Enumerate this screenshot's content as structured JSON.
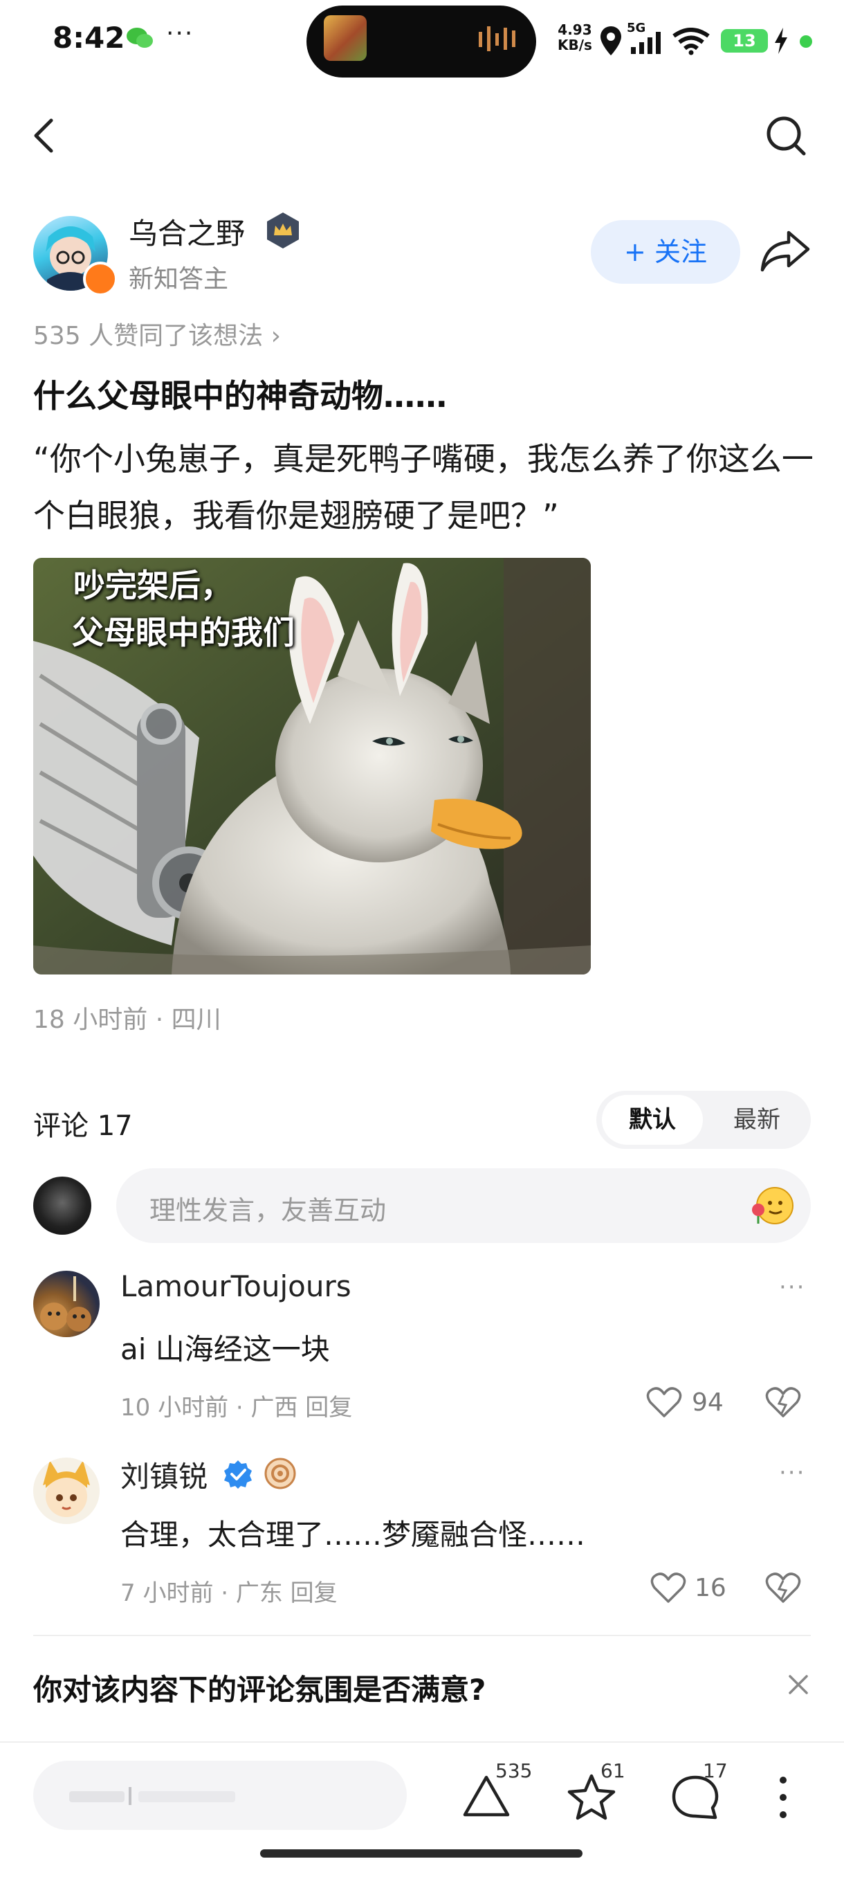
{
  "status_bar": {
    "time": "8:42",
    "dots": "···",
    "speed_value": "4.93",
    "speed_unit": "KB/s",
    "network": "5G",
    "battery": "13"
  },
  "post": {
    "author_name": "乌合之野",
    "author_subtitle": "新知答主",
    "follow_label": "+ 关注",
    "likes_line": "535 人赞同了该想法 ›",
    "title": "什么父母眼中的神奇动物……",
    "body": "“你个小兔崽子，真是死鸭子嘴硬，我怎么养了你这么一个白眼狼，我看你是翅膀硬了是吧？”",
    "image_caption_line1": "吵完架后，",
    "image_caption_line2": "父母眼中的我们",
    "meta": "18 小时前 · 四川"
  },
  "comments": {
    "header": "评论 17",
    "sort_default": "默认",
    "sort_latest": "最新",
    "input_placeholder": "理性发言，友善互动",
    "items": [
      {
        "name": "LamourToujours",
        "text": "ai 山海经这一块",
        "meta": "10 小时前 · 广西 回复",
        "likes": "94",
        "more": "···"
      },
      {
        "name": "刘镇锐",
        "text": "合理，太合理了……梦魇融合怪……",
        "meta": "7 小时前 · 广东 回复",
        "likes": "16",
        "more": "···"
      }
    ]
  },
  "survey": {
    "question": "你对该内容下的评论氛围是否满意?"
  },
  "bottom_bar": {
    "upvote_count": "535",
    "favorite_count": "61",
    "comment_count": "17"
  },
  "colors": {
    "accent": "#1772f6",
    "follow_bg": "#e8f0fd",
    "battery": "#4cd964"
  },
  "icons": [
    "back-icon",
    "search-icon",
    "crown-icon",
    "share-icon",
    "emoji-icon",
    "heart-icon",
    "dislike-heart-icon",
    "verified-icon",
    "level-badge-icon",
    "close-icon",
    "upvote-icon",
    "star-icon",
    "comment-icon",
    "more-vertical-icon"
  ]
}
